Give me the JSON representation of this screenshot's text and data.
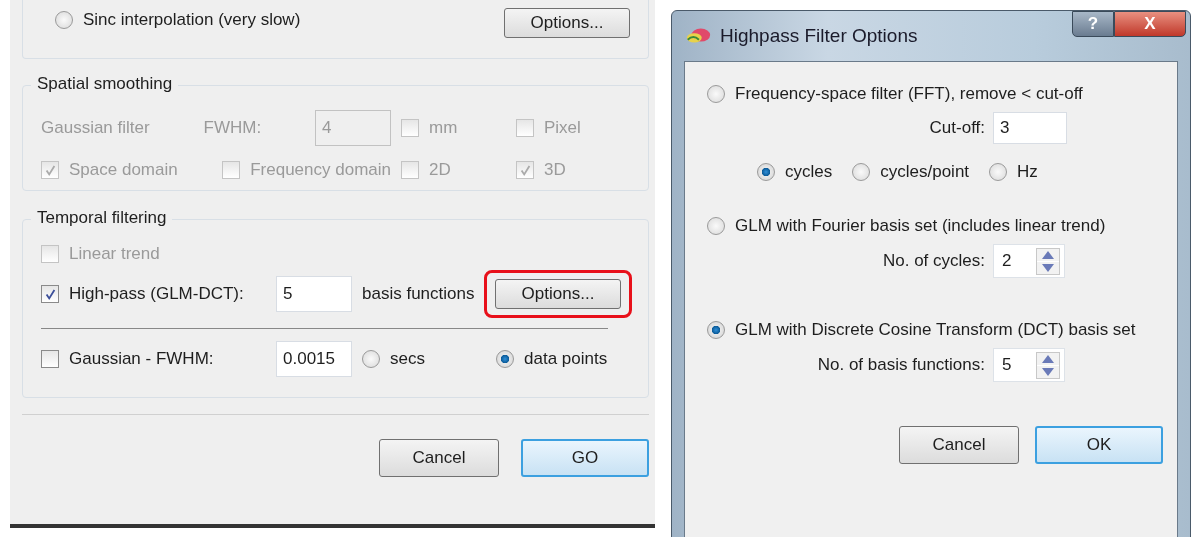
{
  "main_window": {
    "interpolation": {
      "label": "Sinc interpolation (very slow)",
      "selected": false,
      "button": "Options..."
    },
    "groups": [
      {
        "title": "Spatial smoothing",
        "kind": "spatial",
        "disabled": true,
        "rows": [
          [
            [
              {
                "kind": "text",
                "label": "Gaussian filter"
              },
              {
                "kind": "text",
                "label": "FWHM:"
              },
              {
                "kind": "field",
                "value": "4"
              }
            ],
            [
              {
                "kind": "checkbox",
                "label": "mm",
                "checked": false
              }
            ],
            [
              {
                "kind": "checkbox",
                "label": "Pixel",
                "checked": false
              }
            ]
          ],
          [
            [
              {
                "kind": "checkbox",
                "label": "Space domain",
                "checked": true
              },
              {
                "kind": "checkbox",
                "label": "Frequency domain",
                "checked": false
              }
            ],
            [
              {
                "kind": "checkbox",
                "label": "2D",
                "checked": false
              }
            ],
            [
              {
                "kind": "checkbox",
                "label": "3D",
                "checked": true
              }
            ]
          ]
        ]
      },
      {
        "title": "Temporal filtering",
        "kind": "temporal",
        "disabled": false,
        "rows": [
          [
            [
              {
                "kind": "checkbox",
                "label": "Linear trend",
                "checked": false,
                "disabled": true
              }
            ]
          ],
          [
            [
              {
                "kind": "checkbox",
                "label": "High-pass (GLM-DCT):",
                "checked": true,
                "disabled": false
              }
            ],
            [
              {
                "kind": "field",
                "value": "5"
              }
            ],
            [
              {
                "kind": "text",
                "label": "basis functions"
              }
            ],
            [
              {
                "kind": "button",
                "label": "Options...",
                "highlighted": true
              }
            ]
          ],
          [
            [
              {
                "kind": "checkbox",
                "label": "Gaussian - FWHM:",
                "checked": false,
                "disabled": false
              }
            ],
            [
              {
                "kind": "field",
                "value": "0.0015"
              }
            ],
            [
              {
                "kind": "radio",
                "label": "secs",
                "selected": false
              }
            ],
            [
              {
                "kind": "radio",
                "label": "data points",
                "selected": true
              }
            ]
          ]
        ]
      }
    ],
    "buttons": [
      {
        "label": "Cancel",
        "default": false
      },
      {
        "label": "GO",
        "default": true
      }
    ]
  },
  "dialog": {
    "title": "Highpass Filter Options",
    "help_button": "?",
    "close_button": "X",
    "options": [
      {
        "label": "Frequency-space filter (FFT), remove < cut-off",
        "selected": false,
        "settings": [
          {
            "kind": "field",
            "label": "Cut-off:",
            "value": "3"
          },
          {
            "kind": "radios",
            "choices": [
              {
                "label": "cycles",
                "selected": true
              },
              {
                "label": "cycles/point",
                "selected": false
              },
              {
                "label": "Hz",
                "selected": false
              }
            ]
          }
        ]
      },
      {
        "label": "GLM with Fourier basis set (includes linear trend)",
        "selected": false,
        "settings": [
          {
            "kind": "spin",
            "label": "No. of cycles:",
            "value": "2"
          }
        ]
      },
      {
        "label": "GLM with Discrete Cosine Transform (DCT) basis set",
        "selected": true,
        "settings": [
          {
            "kind": "spin",
            "label": "No. of basis functions:",
            "value": "5"
          }
        ]
      }
    ],
    "buttons": [
      {
        "label": "Cancel",
        "default": false
      },
      {
        "label": "OK",
        "default": true
      }
    ]
  }
}
